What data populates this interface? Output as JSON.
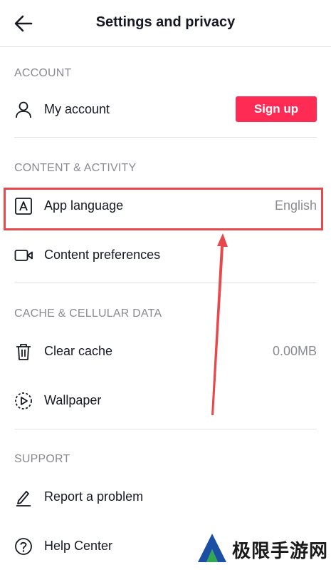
{
  "header": {
    "title": "Settings and privacy",
    "back_icon": "back-arrow-icon"
  },
  "sections": {
    "account": {
      "heading": "ACCOUNT",
      "my_account": {
        "label": "My account",
        "icon": "user-icon"
      },
      "signup_label": "Sign up"
    },
    "content": {
      "heading": "CONTENT & ACTIVITY",
      "app_language": {
        "label": "App language",
        "value": "English",
        "icon": "language-icon"
      },
      "content_prefs": {
        "label": "Content preferences",
        "icon": "video-icon"
      }
    },
    "cache": {
      "heading": "CACHE & CELLULAR DATA",
      "clear_cache": {
        "label": "Clear cache",
        "value": "0.00MB",
        "icon": "trash-icon"
      },
      "wallpaper": {
        "label": "Wallpaper",
        "icon": "wallpaper-icon"
      }
    },
    "support": {
      "heading": "SUPPORT",
      "report": {
        "label": "Report a problem",
        "icon": "edit-icon"
      },
      "help": {
        "label": "Help Center",
        "icon": "help-icon"
      }
    }
  },
  "watermark": {
    "text": "极限手游网"
  },
  "colors": {
    "accent": "#fe2c55",
    "annotation": "#e8474b",
    "muted": "#8a8b91",
    "text": "#161823"
  }
}
